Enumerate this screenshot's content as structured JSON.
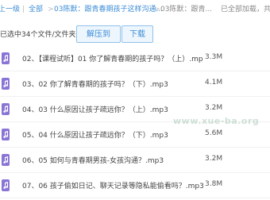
{
  "breadcrumb": {
    "back_prefix": "上一级",
    "sep1": "|",
    "all_files": "全部",
    "sep2": ">",
    "folder1": "03陈默：跟青春期孩子这样沟通...",
    "sep3": ">",
    "folder2": "03陈默：跟青...",
    "status": "已全部加载，共"
  },
  "toolbar": {
    "selected_info": "已选中34个文件/文件夹",
    "unzip_label": "解压到",
    "download_label": "下载"
  },
  "files": [
    {
      "name": "02、【课程试听】01 你了解青春期的孩子吗？（上）.mp3",
      "size": "3.3M"
    },
    {
      "name": "03、02 你了解青春期的孩子吗？（下）.mp3",
      "size": "4.1M"
    },
    {
      "name": "04、03 什么原因让孩子疏远你？（上）.mp3",
      "size": "3.2M"
    },
    {
      "name": "05、04 什么原因让孩子疏远你？（下）.mp3",
      "size": "5.6M"
    },
    {
      "name": "06、05 如何与青春期男孩-女孩沟通？.mp3",
      "size": "3.2M"
    },
    {
      "name": "07、06 孩子偷如日记、聊天记录等隐私能偷看吗？.mp3",
      "size": "3.8M"
    }
  ],
  "watermark": "www.xue-ba.org",
  "icons": {
    "file": "music-file-icon"
  },
  "colors": {
    "accent": "#3b8cd6",
    "file_icon": "#8a75d6"
  }
}
